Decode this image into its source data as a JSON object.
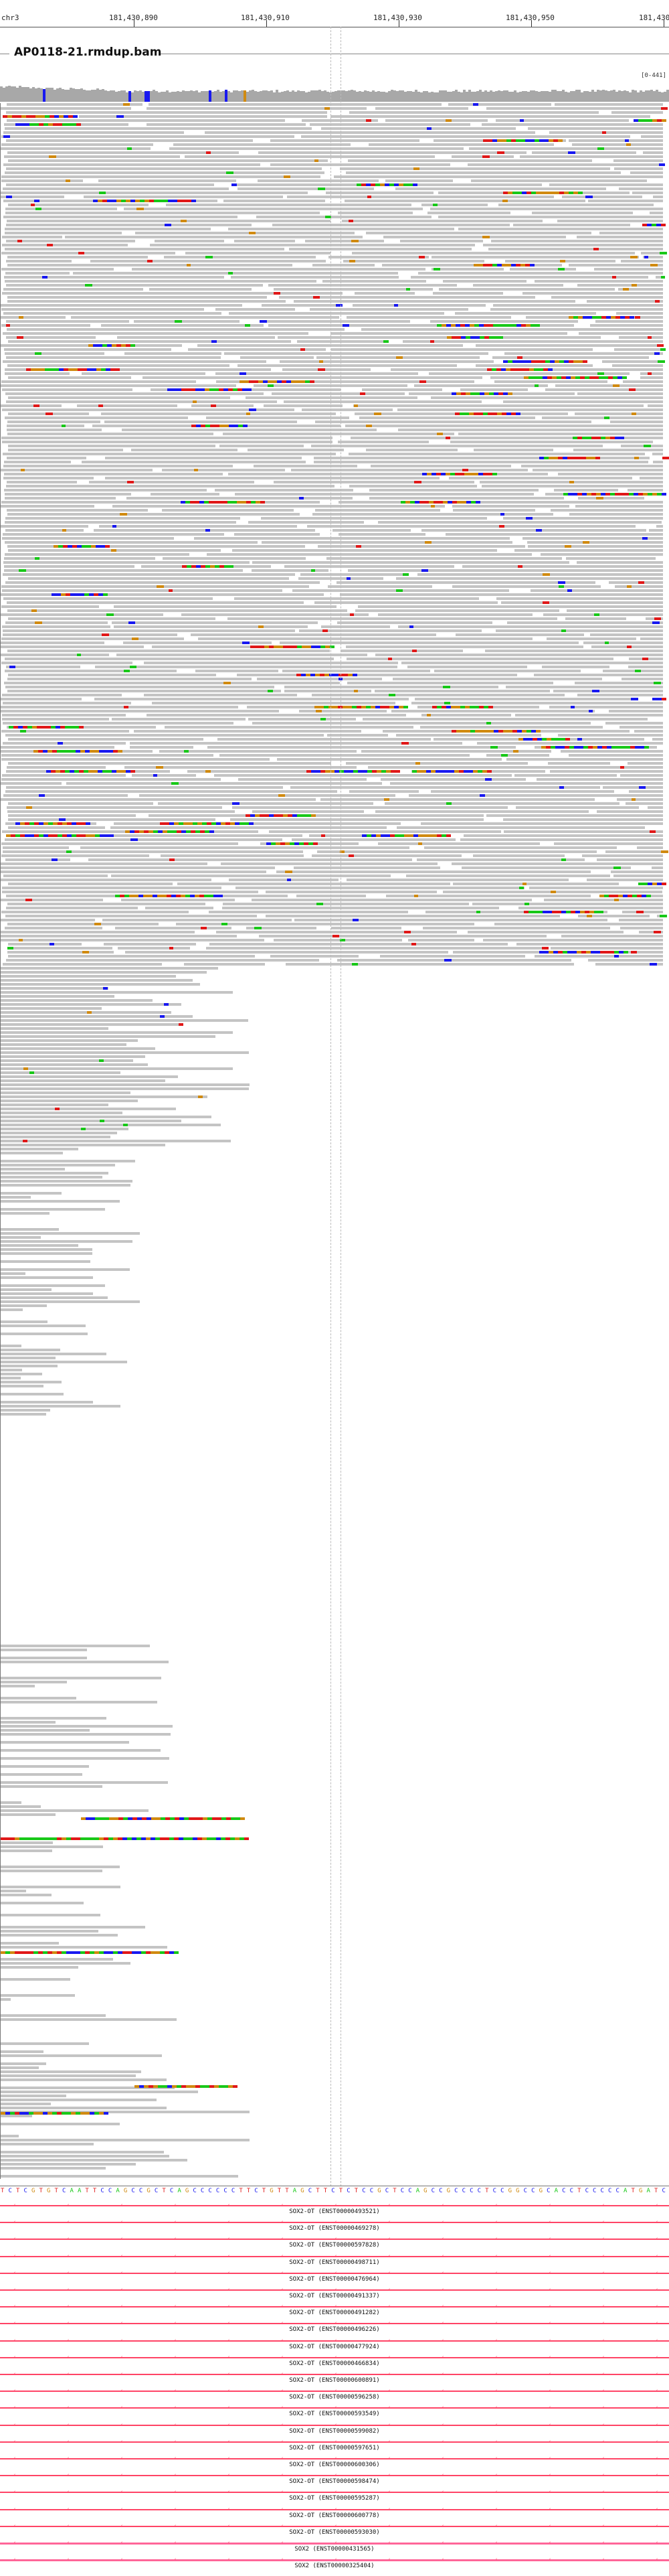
{
  "ruler": {
    "chromosome": "chr3",
    "positions": [
      "181,430,890",
      "181,430,910",
      "181,430,930",
      "181,430,950",
      "181,430"
    ]
  },
  "track": {
    "title": "AP0118-21.rmdup.bam",
    "coverage_scale": "[0-441]"
  },
  "sequence": "TCTCGTGTCAATTCCAGCCGCTCAGCCCCCCTTCTGTTAGCTTCTCTCCGCTCCAGCCGCCCCTCCGGCCGCACCTCCCCCATGATC",
  "transcripts": [
    "SOX2-OT (ENST00000493521)",
    "SOX2-OT (ENST00000469278)",
    "SOX2-OT (ENST00000597828)",
    "SOX2-OT (ENST00000498711)",
    "SOX2-OT (ENST00000476964)",
    "SOX2-OT (ENST00000491337)",
    "SOX2-OT (ENST00000491282)",
    "SOX2-OT (ENST00000496226)",
    "SOX2-OT (ENST00000477924)",
    "SOX2-OT (ENST00000466834)",
    "SOX2-OT (ENST00000600891)",
    "SOX2-OT (ENST00000596258)",
    "SOX2-OT (ENST00000593549)",
    "SOX2-OT (ENST00000599082)",
    "SOX2-OT (ENST00000597651)",
    "SOX2-OT (ENST00000600306)",
    "SOX2-OT (ENST00000598474)",
    "SOX2-OT (ENST00000595287)",
    "SOX2-OT (ENST00000600778)",
    "SOX2-OT (ENST00000593030)",
    "SOX2 (ENST00000431565)",
    "SOX2 (ENST00000325404)"
  ],
  "colors": {
    "read": "#c4c4c4",
    "A": "#18c818",
    "C": "#1818f0",
    "G": "#d08a10",
    "T": "#e01818",
    "feature": "#ff4466"
  }
}
